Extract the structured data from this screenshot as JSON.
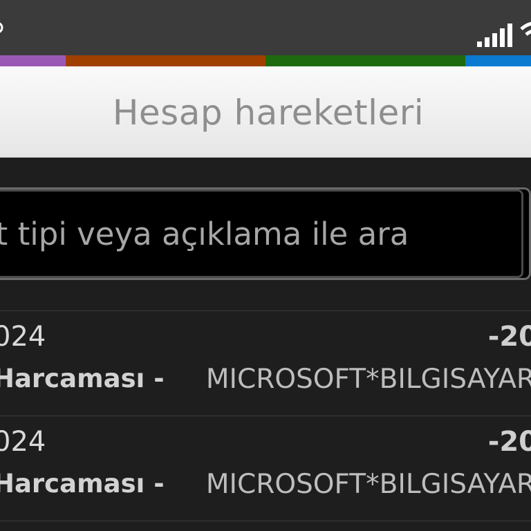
{
  "status_bar": {
    "left_icon": "notification-icon",
    "signal_icon": "signal-icon",
    "wifi_icon": "wifi-icon"
  },
  "color_strip": [
    {
      "color": "#9b59b6",
      "width": 95
    },
    {
      "color": "#a04000",
      "width": 289
    },
    {
      "color": "#1e6b0f",
      "width": 289
    },
    {
      "color": "#0b7ad1",
      "width": 95
    }
  ],
  "header": {
    "title": "Hesap hareketleri"
  },
  "search": {
    "placeholder": "et tipi veya açıklama ile ara"
  },
  "transactions": [
    {
      "date": "024",
      "amount": "-20",
      "type": "Harcaması -",
      "description": "MICROSOFT*BILGISAYAR"
    },
    {
      "date": "024",
      "amount": "-20",
      "type": "Harcaması -",
      "description": "MICROSOFT*BILGISAYAR"
    }
  ]
}
